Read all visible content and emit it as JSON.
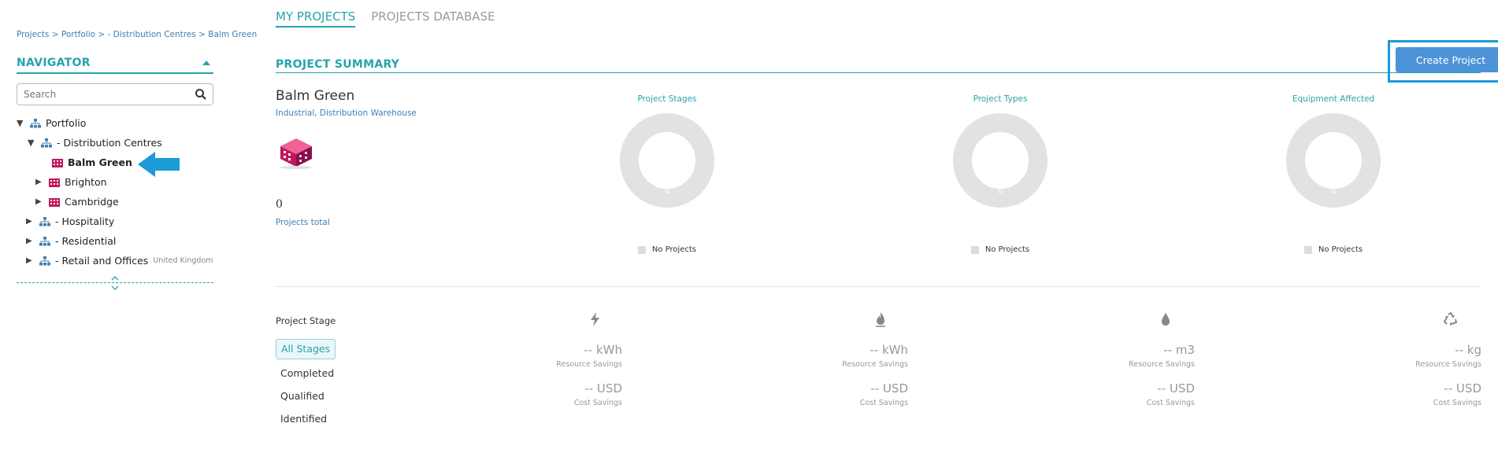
{
  "top_tabs": [
    {
      "label": "MY PROJECTS"
    },
    {
      "label": "PROJECTS DATABASE"
    }
  ],
  "breadcrumb": "Projects > Portfolio > - Distribution Centres > Balm Green",
  "navigator": {
    "title": "NAVIGATOR",
    "search_placeholder": "Search",
    "tree": [
      {
        "label": "Portfolio"
      },
      {
        "label": "- Distribution Centres"
      },
      {
        "label": "Balm Green"
      },
      {
        "label": "Brighton"
      },
      {
        "label": "Cambridge"
      },
      {
        "label": "- Hospitality"
      },
      {
        "label": "- Residential"
      },
      {
        "label": "- Retail and Offices",
        "sub": "United Kingdom"
      }
    ]
  },
  "summary": {
    "title": "PROJECT SUMMARY",
    "create_label": "Create Project",
    "site_name": "Balm Green",
    "site_type": "Industrial, Distribution Warehouse",
    "total": "0",
    "total_label": "Projects total"
  },
  "charts": [
    {
      "title": "Project Stages",
      "value": "0",
      "legend": "No Projects"
    },
    {
      "title": "Project Types",
      "value": "0",
      "legend": "No Projects"
    },
    {
      "title": "Equipment Affected",
      "value": "0",
      "legend": "No Projects"
    }
  ],
  "stages": {
    "title": "Project Stage",
    "items": [
      "All Stages",
      "Completed",
      "Qualified",
      "Identified"
    ]
  },
  "metrics": [
    {
      "icon": "lightning-icon",
      "resource": "-- kWh",
      "resource_label": "Resource Savings",
      "cost": "-- USD",
      "cost_label": "Cost Savings"
    },
    {
      "icon": "flame-icon",
      "resource": "-- kWh",
      "resource_label": "Resource Savings",
      "cost": "-- USD",
      "cost_label": "Cost Savings"
    },
    {
      "icon": "water-drop-icon",
      "resource": "-- m3",
      "resource_label": "Resource Savings",
      "cost": "-- USD",
      "cost_label": "Cost Savings"
    },
    {
      "icon": "recycle-icon",
      "resource": "-- kg",
      "resource_label": "Resource Savings",
      "cost": "-- USD",
      "cost_label": "Cost Savings"
    }
  ],
  "colors": {
    "accent": "#27a3ad",
    "link": "#3d7fb5",
    "button": "#4d93d8",
    "highlight": "#1a9ad6"
  }
}
